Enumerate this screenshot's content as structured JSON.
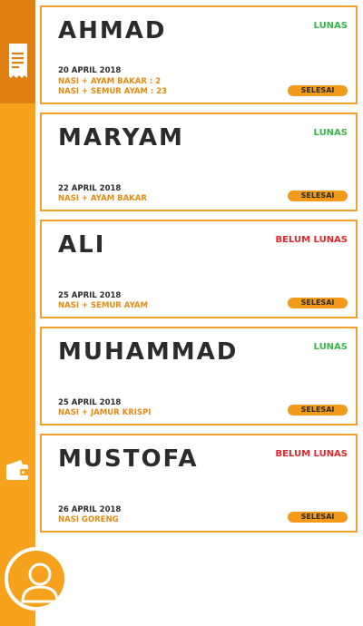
{
  "orders": [
    {
      "name": "AHMAD",
      "status": "LUNAS",
      "paid": true,
      "date": "20 APRIL 2018",
      "items": [
        "NASI + AYAM BAKAR : 2",
        "NASI + SEMUR AYAM : 23"
      ],
      "action": "SELESAI"
    },
    {
      "name": "MARYAM",
      "status": "LUNAS",
      "paid": true,
      "date": "22 APRIL 2018",
      "items": [
        "NASI + AYAM BAKAR"
      ],
      "action": "SELESAI"
    },
    {
      "name": "ALI",
      "status": "BELUM LUNAS",
      "paid": false,
      "date": "25 APRIL 2018",
      "items": [
        "NASI + SEMUR AYAM"
      ],
      "action": "SELESAI"
    },
    {
      "name": "MUHAMMAD",
      "status": "LUNAS",
      "paid": true,
      "date": "25 APRIL 2018",
      "items": [
        "NASI + JAMUR KRISPI"
      ],
      "action": "SELESAI"
    },
    {
      "name": "MUSTOFA",
      "status": "BELUM LUNAS",
      "paid": false,
      "date": "26 APRIL 2018",
      "items": [
        "NASI GORENG"
      ],
      "action": "SELESAI"
    }
  ],
  "sidebar": {
    "icons": [
      "receipt-icon",
      "wallet-icon",
      "user-avatar-icon"
    ],
    "active": "receipt-icon"
  },
  "colors": {
    "sidebar": "#f7a21d",
    "sidebar_active": "#e07f12",
    "card_border": "#f3a02c",
    "paid": "#3ab54a",
    "unpaid": "#e0262b",
    "item_text": "#e68a12",
    "button": "#f39a1b"
  }
}
